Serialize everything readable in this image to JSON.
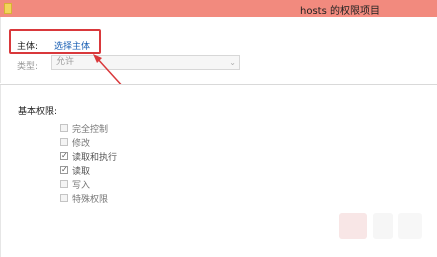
{
  "window": {
    "title": "hosts 的权限项目"
  },
  "principal": {
    "label": "主体:",
    "link": "选择主体"
  },
  "type": {
    "label": "类型:",
    "value": "允许"
  },
  "permissions": {
    "heading": "基本权限:",
    "items": [
      {
        "label": "完全控制",
        "checked": false
      },
      {
        "label": "修改",
        "checked": false
      },
      {
        "label": "读取和执行",
        "checked": true
      },
      {
        "label": "读取",
        "checked": true
      },
      {
        "label": "写入",
        "checked": false
      },
      {
        "label": "特殊权限",
        "checked": false
      }
    ]
  },
  "colors": {
    "titlebar": "#f28a7e",
    "highlight": "#d9383b",
    "link": "#1a5fb4"
  }
}
